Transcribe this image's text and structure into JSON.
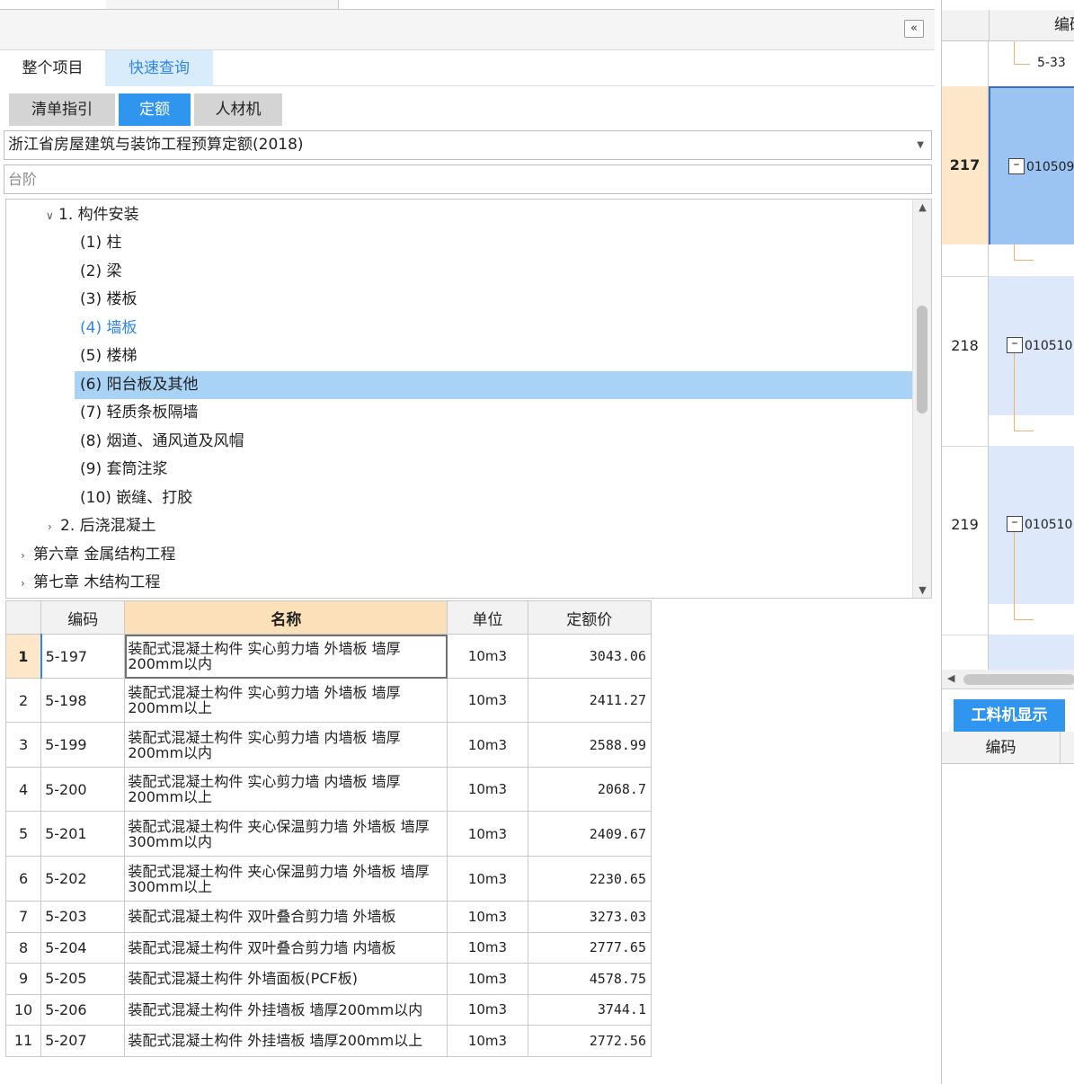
{
  "colors": {
    "accent": "#2f95ee",
    "selected_row": "#a8d3f7",
    "header_highlight": "#fbe0b9",
    "tree_link": "#2f86e6"
  },
  "toolbar": {
    "collapse_icon": "double-chevron-left"
  },
  "scope_tabs": {
    "whole": "整个项目",
    "quick": "快速查询"
  },
  "kind_tabs": {
    "guide": "清单指引",
    "quota": "定额",
    "labor": "人材机"
  },
  "standard_select": {
    "value": "浙江省房屋建筑与装饰工程预算定额(2018)"
  },
  "search": {
    "value": "台阶"
  },
  "tree": {
    "items": [
      {
        "label": "1. 构件安装"
      },
      {
        "label": "(1) 柱"
      },
      {
        "label": "(2) 梁"
      },
      {
        "label": "(3) 楼板"
      },
      {
        "label": "(4) 墙板"
      },
      {
        "label": "(5) 楼梯"
      },
      {
        "label": "(6) 阳台板及其他"
      },
      {
        "label": "(7) 轻质条板隔墙"
      },
      {
        "label": "(8) 烟道、通风道及风帽"
      },
      {
        "label": "(9) 套筒注浆"
      },
      {
        "label": "(10) 嵌缝、打胶"
      },
      {
        "label": "2. 后浇混凝土"
      },
      {
        "label": "第六章 金属结构工程"
      },
      {
        "label": "第七章 木结构工程"
      }
    ]
  },
  "grid": {
    "headers": {
      "code": "编码",
      "name": "名称",
      "unit": "单位",
      "price": "定额价"
    },
    "rows": [
      {
        "idx": "1",
        "code": "5-197",
        "name": "装配式混凝土构件 实心剪力墙 外墙板 墙厚200mm以内",
        "unit": "10m3",
        "price": "3043.06"
      },
      {
        "idx": "2",
        "code": "5-198",
        "name": "装配式混凝土构件 实心剪力墙 外墙板 墙厚200mm以上",
        "unit": "10m3",
        "price": "2411.27"
      },
      {
        "idx": "3",
        "code": "5-199",
        "name": "装配式混凝土构件 实心剪力墙 内墙板 墙厚200mm以内",
        "unit": "10m3",
        "price": "2588.99"
      },
      {
        "idx": "4",
        "code": "5-200",
        "name": "装配式混凝土构件 实心剪力墙 内墙板 墙厚200mm以上",
        "unit": "10m3",
        "price": "2068.7"
      },
      {
        "idx": "5",
        "code": "5-201",
        "name": "装配式混凝土构件 夹心保温剪力墙 外墙板 墙厚300mm以内",
        "unit": "10m3",
        "price": "2409.67"
      },
      {
        "idx": "6",
        "code": "5-202",
        "name": "装配式混凝土构件 夹心保温剪力墙 外墙板 墙厚300mm以上",
        "unit": "10m3",
        "price": "2230.65"
      },
      {
        "idx": "7",
        "code": "5-203",
        "name": "装配式混凝土构件 双叶叠合剪力墙 外墙板",
        "unit": "10m3",
        "price": "3273.03"
      },
      {
        "idx": "8",
        "code": "5-204",
        "name": "装配式混凝土构件 双叶叠合剪力墙 内墙板",
        "unit": "10m3",
        "price": "2777.65"
      },
      {
        "idx": "9",
        "code": "5-205",
        "name": "装配式混凝土构件 外墙面板(PCF板)",
        "unit": "10m3",
        "price": "4578.75"
      },
      {
        "idx": "10",
        "code": "5-206",
        "name": "装配式混凝土构件 外挂墙板 墙厚200mm以内",
        "unit": "10m3",
        "price": "3744.1"
      },
      {
        "idx": "11",
        "code": "5-207",
        "name": "装配式混凝土构件 外挂墙板 墙厚200mm以上",
        "unit": "10m3",
        "price": "2772.56"
      }
    ]
  },
  "right": {
    "header_code": "编码",
    "rows": [
      {
        "num": "",
        "code": "5-33"
      },
      {
        "num": "217",
        "code": "010509"
      },
      {
        "num": "218",
        "code": "010510"
      },
      {
        "num": "219",
        "code": "010510"
      }
    ],
    "labor_tab": "工料机显示",
    "sub_header_code": "编码"
  }
}
